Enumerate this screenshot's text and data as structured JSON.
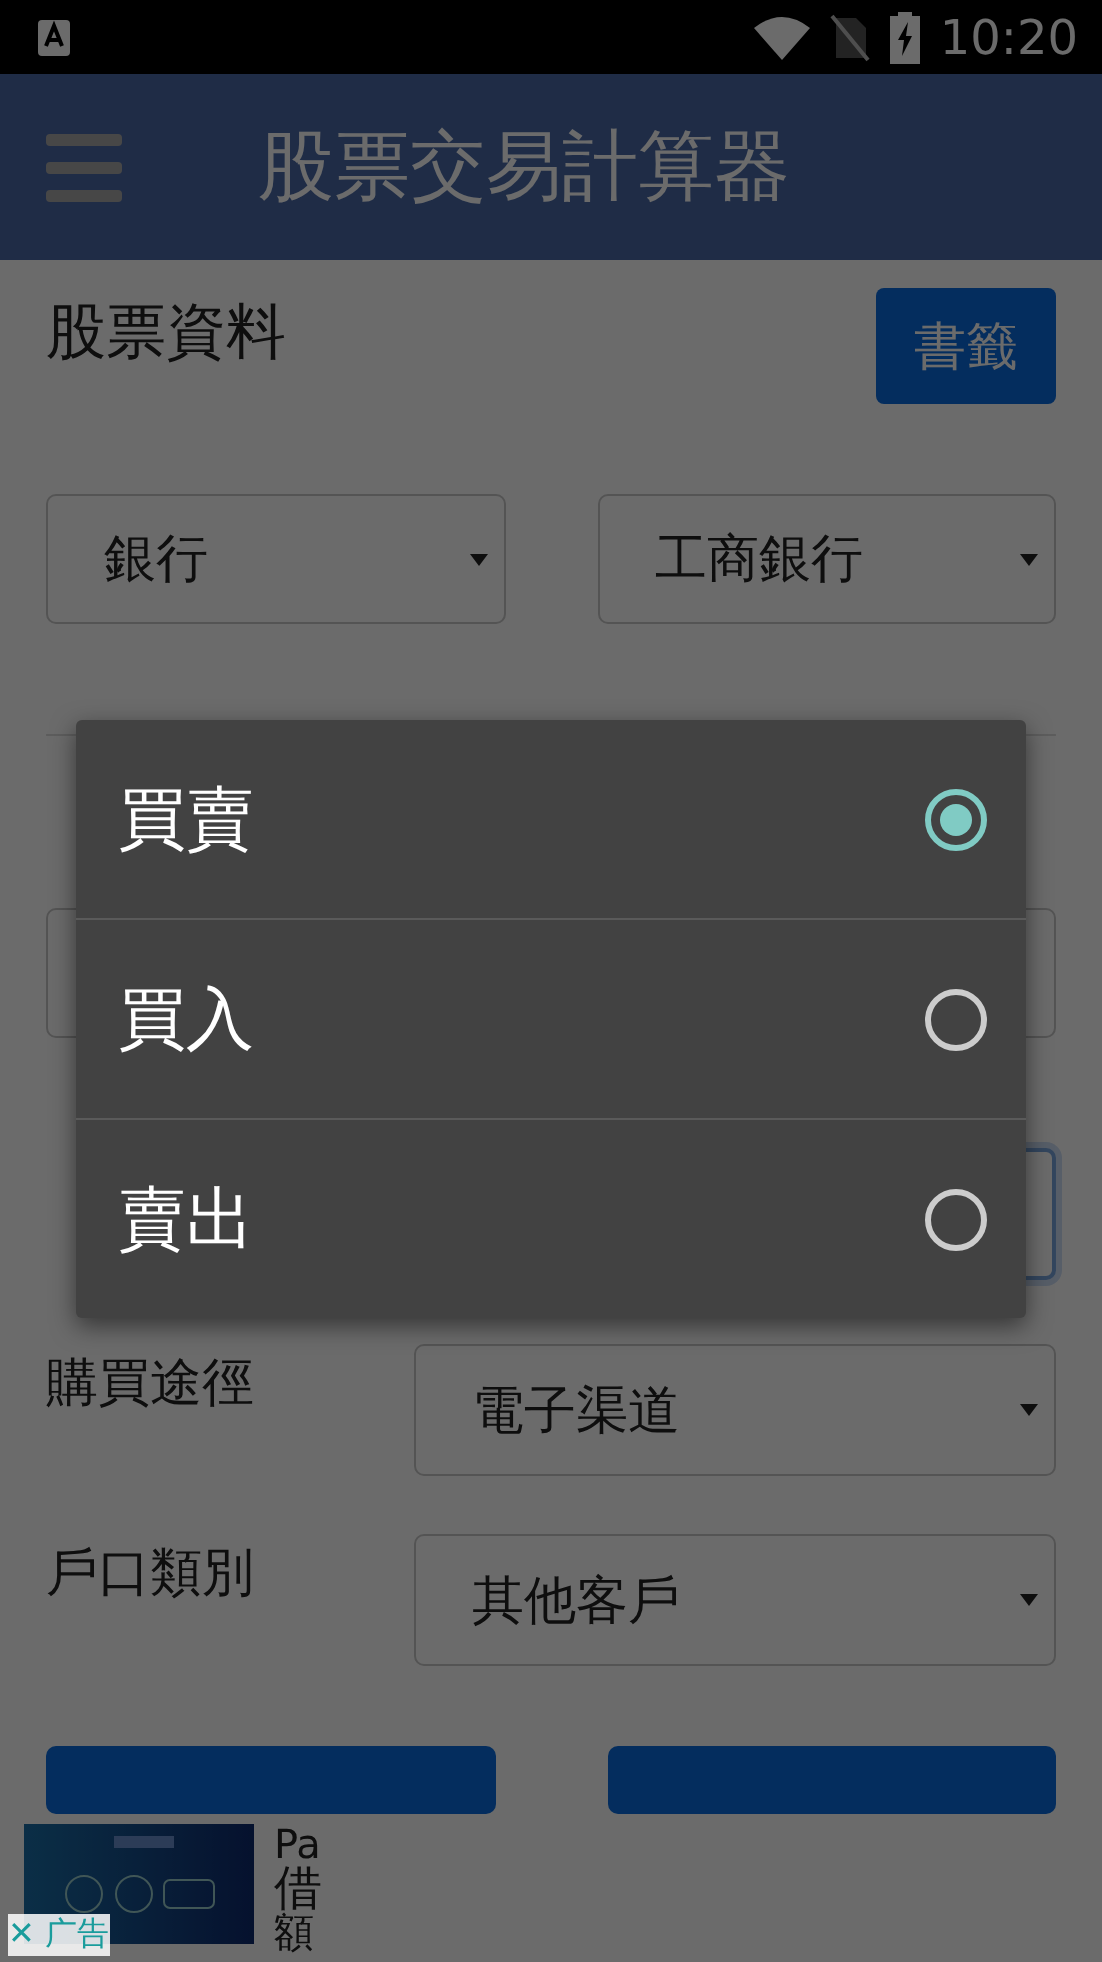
{
  "status_bar": {
    "time": "10:20"
  },
  "app_bar": {
    "title": "股票交易計算器"
  },
  "section": {
    "title": "股票資料",
    "bookmark_button": "書籤"
  },
  "stock_selects": [
    {
      "value": "銀行"
    },
    {
      "value": "工商銀行"
    }
  ],
  "form_rows": [
    {
      "kind": "select",
      "label": "購買途徑",
      "value": "電子渠道"
    },
    {
      "kind": "select",
      "label": "戶口類別",
      "value": "其他客戶"
    }
  ],
  "dialog": {
    "options": [
      {
        "label": "買賣",
        "selected": true
      },
      {
        "label": "買入",
        "selected": false
      },
      {
        "label": "賣出",
        "selected": false
      }
    ]
  },
  "ad": {
    "kind": "picture",
    "line_1": "Pa",
    "line_2": "借",
    "line_3": "額",
    "close_label": "✕ 广告"
  }
}
